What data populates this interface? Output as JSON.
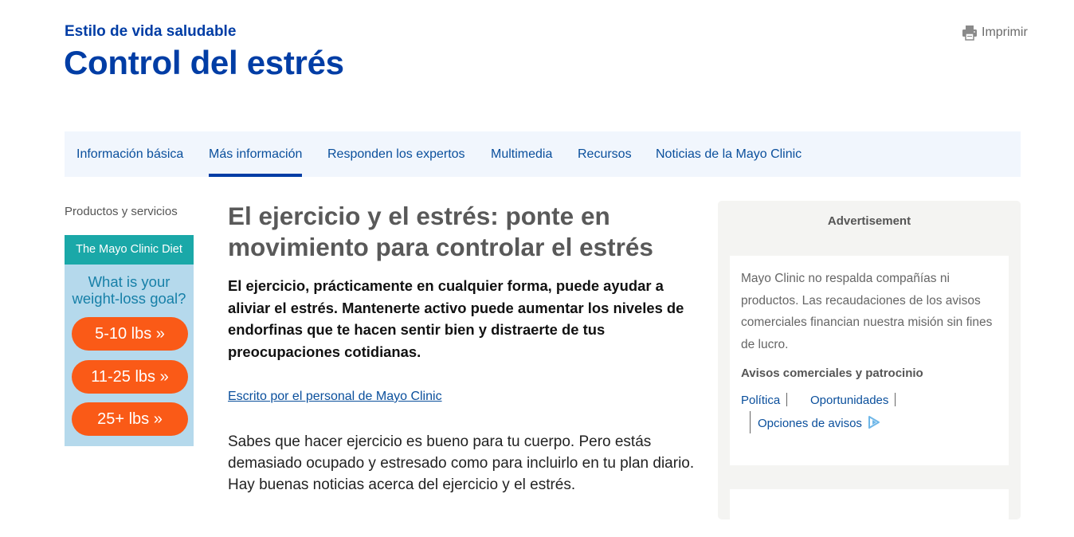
{
  "header": {
    "eyebrow": "Estilo de vida saludable",
    "title": "Control del estrés",
    "print_label": "Imprimir"
  },
  "tabs": [
    {
      "label": "Información básica",
      "active": false
    },
    {
      "label": "Más información",
      "active": true
    },
    {
      "label": "Responden los expertos",
      "active": false
    },
    {
      "label": "Multimedia",
      "active": false
    },
    {
      "label": "Recursos",
      "active": false
    },
    {
      "label": "Noticias de la Mayo Clinic",
      "active": false
    }
  ],
  "sidebar": {
    "label": "Productos y servicios",
    "promo": {
      "header": "The Mayo Clinic Diet",
      "question": "What is your weight-loss goal?",
      "buttons": [
        "5-10 lbs »",
        "11-25 lbs »",
        "25+ lbs »"
      ]
    }
  },
  "article": {
    "title": "El ejercicio y el estrés: ponte en movimiento para controlar el estrés",
    "lede": "El ejercicio, prácticamente en cualquier forma, puede ayudar a aliviar el estrés. Mantenerte activo puede aumentar los niveles de endorfinas que te hacen sentir bien y distraerte de tus preocupaciones cotidianas.",
    "byline": "Escrito por el personal de Mayo Clinic",
    "body": "Sabes que hacer ejercicio es bueno para tu cuerpo. Pero estás demasiado ocupado y estresado como para incluirlo en tu plan diario. Hay buenas noticias acerca del ejercicio y el estrés."
  },
  "ad": {
    "label": "Advertisement",
    "disclaimer": "Mayo Clinic no respalda compañías ni productos. Las recaudaciones de los avisos comerciales financian nuestra misión sin fines de lucro.",
    "subheading": "Avisos comerciales y patrocinio",
    "links": {
      "politica": "Política",
      "oportunidades": "Oportunidades",
      "opciones": "Opciones de avisos"
    }
  },
  "colors": {
    "brand_blue": "#003da5",
    "tabbar_bg": "#f1f6fd",
    "promo_teal": "#1aa8a8",
    "promo_orange": "#fa5a17",
    "promo_bg": "#b5d9ec"
  },
  "icons": {
    "print": "printer-icon",
    "adchoices": "adchoices-icon"
  }
}
